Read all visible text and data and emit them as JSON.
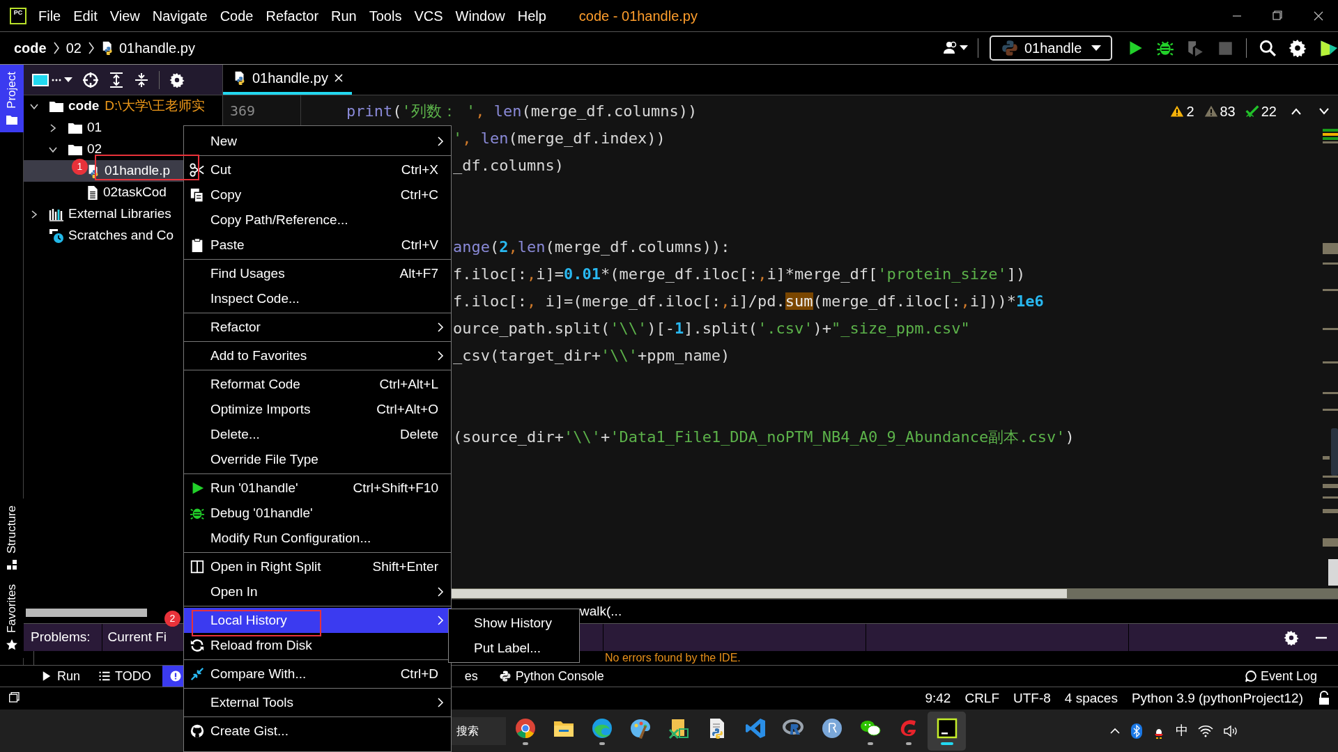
{
  "app_logo": "PC",
  "menu_bar": [
    "File",
    "Edit",
    "View",
    "Navigate",
    "Code",
    "Refactor",
    "Run",
    "Tools",
    "VCS",
    "Window",
    "Help"
  ],
  "window_title": "code - 01handle.py",
  "breadcrumb": [
    "code",
    "02",
    "01handle.py"
  ],
  "run_configuration": "01handle",
  "side_tabs": [
    {
      "label": "Project",
      "selected": true
    },
    {
      "label": "Structure",
      "selected": false
    },
    {
      "label": "Favorites",
      "selected": false
    }
  ],
  "project_tree": [
    {
      "label": "code",
      "path": "D:\\大学\\王老师实",
      "kind": "folder",
      "expanded": true,
      "selected": false,
      "children": [
        {
          "label": "01",
          "kind": "folder",
          "expanded": false,
          "selected": false
        },
        {
          "label": "02",
          "kind": "folder",
          "expanded": true,
          "selected": false,
          "children": [
            {
              "label": "01handle.p",
              "kind": "pyfile",
              "selected": true
            },
            {
              "label": "02taskCod",
              "kind": "textfile",
              "selected": false
            }
          ]
        }
      ]
    },
    {
      "label": "External Libraries",
      "kind": "libraries",
      "expanded": false,
      "selected": false
    },
    {
      "label": "Scratches and Co",
      "kind": "scratches",
      "selected": false
    }
  ],
  "editor": {
    "tab": "01handle.py",
    "line_number": "369",
    "code_line": [
      {
        "kind": "builtin",
        "t": "print"
      },
      {
        "kind": "plain",
        "t": "("
      },
      {
        "kind": "string",
        "t": "'列数： '"
      },
      {
        "kind": "punct",
        "t": ","
      },
      {
        "kind": "builtin",
        "t": " len"
      },
      {
        "kind": "plain",
        "t": "(merge_df.columns))"
      }
    ],
    "partial_code_blocks": [
      [
        [
          {
            "kind": "string",
            "t": "'"
          },
          {
            "kind": "punct",
            "t": ","
          },
          {
            "kind": "builtin",
            "t": " len"
          },
          {
            "kind": "plain",
            "t": "(merge_df.index))"
          }
        ],
        [
          {
            "kind": "plain",
            "t": "_df.columns)"
          }
        ]
      ],
      [
        [
          {
            "kind": "builtin",
            "t": "ange"
          },
          {
            "kind": "plain",
            "t": "("
          },
          {
            "kind": "number",
            "t": "2"
          },
          {
            "kind": "punct",
            "t": ","
          },
          {
            "kind": "builtin",
            "t": "len"
          },
          {
            "kind": "plain",
            "t": "(merge_df.columns)):"
          }
        ],
        [
          {
            "kind": "plain",
            "t": "f.iloc[:"
          },
          {
            "kind": "punct",
            "t": ","
          },
          {
            "kind": "plain",
            "t": "i]="
          },
          {
            "kind": "number",
            "t": "0.01"
          },
          {
            "kind": "plain",
            "t": "*(merge_df.iloc[:"
          },
          {
            "kind": "punct",
            "t": ","
          },
          {
            "kind": "plain",
            "t": "i]*merge_df["
          },
          {
            "kind": "string",
            "t": "'protein_size'"
          },
          {
            "kind": "plain",
            "t": "])"
          }
        ],
        [
          {
            "kind": "plain",
            "t": "f.iloc[:"
          },
          {
            "kind": "punct",
            "t": ","
          },
          {
            "kind": "plain",
            "t": " i]=(merge_df.iloc[:"
          },
          {
            "kind": "punct",
            "t": ","
          },
          {
            "kind": "plain",
            "t": "i]/pd."
          },
          {
            "kind": "match",
            "t": "sum"
          },
          {
            "kind": "plain",
            "t": "(merge_df.iloc[:"
          },
          {
            "kind": "punct",
            "t": ","
          },
          {
            "kind": "plain",
            "t": "i]))*"
          },
          {
            "kind": "number",
            "t": "1e6"
          }
        ],
        [
          {
            "kind": "plain",
            "t": "ource_path.split("
          },
          {
            "kind": "string",
            "t": "'\\\\'"
          },
          {
            "kind": "plain",
            "t": ")[-"
          },
          {
            "kind": "number",
            "t": "1"
          },
          {
            "kind": "plain",
            "t": "].split("
          },
          {
            "kind": "string",
            "t": "'.csv'"
          },
          {
            "kind": "plain",
            "t": ")+"
          },
          {
            "kind": "string",
            "t": "\"_size_ppm.csv\""
          }
        ],
        [
          {
            "kind": "plain",
            "t": "_csv(target_dir+"
          },
          {
            "kind": "string",
            "t": "'\\\\'"
          },
          {
            "kind": "plain",
            "t": "+ppm_name)"
          }
        ]
      ],
      [
        [
          {
            "kind": "plain",
            "t": "(source_dir+"
          },
          {
            "kind": "string",
            "t": "'\\\\'"
          },
          {
            "kind": "plain",
            "t": "+"
          },
          {
            "kind": "string",
            "t": "'Data1_File1_DDA_noPTM_NB4_A0_9_Abundance副本.csv'"
          },
          {
            "kind": "plain",
            "t": ")"
          }
        ]
      ]
    ],
    "inspections": [
      {
        "kind": "error",
        "count": "2"
      },
      {
        "kind": "warning",
        "count": "83"
      },
      {
        "kind": "typo",
        "count": "22"
      }
    ],
    "breadcrumb_fragment": "walk(..."
  },
  "context_menu": [
    [
      {
        "label": "New",
        "submenu": true,
        "selected": false
      }
    ],
    [
      {
        "label": "Cut",
        "shortcut": "Ctrl+X",
        "kind": "cut",
        "selected": false
      },
      {
        "label": "Copy",
        "shortcut": "Ctrl+C",
        "kind": "copy",
        "selected": false
      },
      {
        "label": "Copy Path/Reference...",
        "selected": false
      },
      {
        "label": "Paste",
        "shortcut": "Ctrl+V",
        "kind": "paste",
        "selected": false
      }
    ],
    [
      {
        "label": "Find Usages",
        "shortcut": "Alt+F7",
        "selected": false
      },
      {
        "label": "Inspect Code...",
        "selected": false
      }
    ],
    [
      {
        "label": "Refactor",
        "submenu": true,
        "selected": false
      }
    ],
    [
      {
        "label": "Add to Favorites",
        "submenu": true,
        "selected": false
      }
    ],
    [
      {
        "label": "Reformat Code",
        "shortcut": "Ctrl+Alt+L",
        "selected": false
      },
      {
        "label": "Optimize Imports",
        "shortcut": "Ctrl+Alt+O",
        "selected": false
      },
      {
        "label": "Delete...",
        "shortcut": "Delete",
        "selected": false
      },
      {
        "label": "Override File Type",
        "selected": false
      }
    ],
    [
      {
        "label": "Run '01handle'",
        "shortcut": "Ctrl+Shift+F10",
        "kind": "run",
        "selected": false
      },
      {
        "label": "Debug '01handle'",
        "kind": "debug",
        "selected": false
      },
      {
        "label": "Modify Run Configuration...",
        "selected": false
      }
    ],
    [
      {
        "label": "Open in Right Split",
        "shortcut": "Shift+Enter",
        "kind": "split",
        "selected": false
      },
      {
        "label": "Open In",
        "submenu": true,
        "selected": false
      }
    ],
    [
      {
        "label": "Local History",
        "submenu": true,
        "selected": true
      },
      {
        "label": "Reload from Disk",
        "kind": "reload",
        "selected": false
      }
    ],
    [
      {
        "label": "Compare With...",
        "shortcut": "Ctrl+D",
        "kind": "compare",
        "selected": false
      }
    ],
    [
      {
        "label": "External Tools",
        "submenu": true,
        "selected": false
      }
    ],
    [
      {
        "label": "Create Gist...",
        "kind": "github",
        "selected": false
      }
    ]
  ],
  "submenu": [
    {
      "label": "Show History",
      "selected": false
    },
    {
      "label": "Put Label...",
      "selected": false
    }
  ],
  "annotations": [
    "1",
    "2"
  ],
  "problems": {
    "tabs": [
      "Problems:",
      "Current Fi"
    ],
    "message": "No errors found by the IDE."
  },
  "tool_tabs": [
    {
      "kind": "run",
      "label": "Run",
      "selected": false
    },
    {
      "kind": "list",
      "label": "TODO",
      "selected": false
    },
    {
      "kind": "problems",
      "selected": true
    }
  ],
  "tool_tabs_right": [
    {
      "kind": "plain",
      "label": "es"
    },
    {
      "kind": "python",
      "label": "Python Console"
    }
  ],
  "event_log": "Event Log",
  "status_bar": [
    "9:42",
    "CRLF",
    "UTF-8",
    "4 spaces",
    "Python 3.9 (pythonProject12)"
  ],
  "taskbar": {
    "search_placeholder": "搜索",
    "apps": [
      {
        "kind": "chrome",
        "running": true,
        "selected": false
      },
      {
        "kind": "folder",
        "running": false,
        "selected": false
      },
      {
        "kind": "edge",
        "running": true,
        "selected": false
      },
      {
        "kind": "paint",
        "running": false,
        "selected": false
      },
      {
        "kind": "tool",
        "running": false,
        "selected": false
      },
      {
        "kind": "pyfile",
        "running": false,
        "selected": false
      },
      {
        "kind": "vscode",
        "running": false,
        "selected": false
      },
      {
        "kind": "rstudio",
        "running": false,
        "selected": false
      },
      {
        "kind": "r",
        "running": false,
        "selected": false
      },
      {
        "kind": "wechat",
        "running": true,
        "selected": false
      },
      {
        "kind": "redapp",
        "running": true,
        "selected": false
      },
      {
        "kind": "pycharm",
        "running": true,
        "selected": true
      }
    ],
    "ime": "中"
  }
}
